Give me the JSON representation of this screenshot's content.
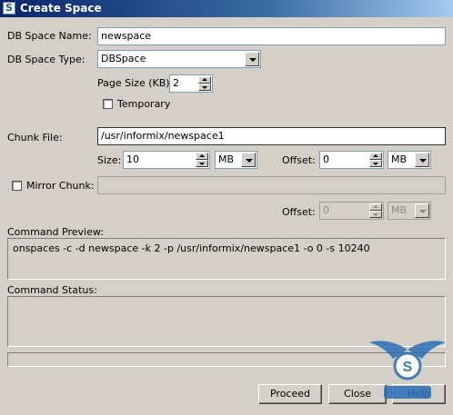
{
  "window": {
    "title": "Create Space"
  },
  "form": {
    "name_label": "DB Space Name:",
    "name_value": "newspace",
    "type_label": "DB Space Type:",
    "type_value": "DBSpace",
    "page_size_label": "Page Size (KB):",
    "page_size_value": "2",
    "temporary_label": "Temporary",
    "chunk_label": "Chunk File:",
    "chunk_value": "/usr/informix/newspace1",
    "size_label": "Size:",
    "size_value": "10",
    "size_unit": "MB",
    "offset_label": "Offset:",
    "offset_value": "0",
    "offset_unit": "MB",
    "mirror_label": "Mirror Chunk:",
    "mirror_value": "",
    "mirror_offset_label": "Offset:",
    "mirror_offset_value": "0",
    "mirror_offset_unit": "MB"
  },
  "preview": {
    "label": "Command Preview:",
    "text": "onspaces -c -d newspace -k 2 -p /usr/informix/newspace1 -o 0 -s 10240"
  },
  "status": {
    "label": "Command Status:",
    "text": ""
  },
  "buttons": {
    "proceed": "Proceed",
    "close": "Close",
    "help": "Help"
  },
  "watermark": {
    "label": "S"
  }
}
